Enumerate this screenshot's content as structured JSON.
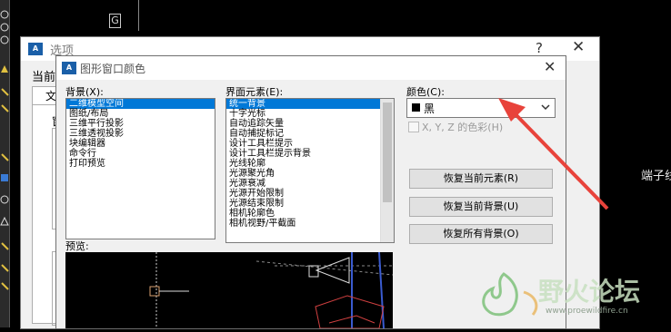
{
  "background": {
    "g_marker": "G",
    "side_text": "端子线",
    "watermark_name": "野火论坛",
    "watermark_url": "www.proewildfire.cn"
  },
  "options_dialog": {
    "logo": "A",
    "title": "选项",
    "help": "?",
    "close": "✕",
    "current_file_label": "当前",
    "tab_label": "文",
    "frag_label": "窗"
  },
  "color_dialog": {
    "logo": "A",
    "title": "图形窗口颜色",
    "close": "✕",
    "context_label": "背景(X):",
    "contexts": [
      {
        "label": "二维模型空间",
        "selected": true
      },
      {
        "label": "图纸/布局",
        "selected": false
      },
      {
        "label": "三维平行投影",
        "selected": false
      },
      {
        "label": "三维透视投影",
        "selected": false
      },
      {
        "label": "块编辑器",
        "selected": false
      },
      {
        "label": "命令行",
        "selected": false
      },
      {
        "label": "打印预览",
        "selected": false
      }
    ],
    "elements_label": "界面元素(E):",
    "elements": [
      {
        "label": "统一背景",
        "selected": true
      },
      {
        "label": "十字光标",
        "selected": false
      },
      {
        "label": "自动追踪矢量",
        "selected": false
      },
      {
        "label": "自动捕捉标记",
        "selected": false
      },
      {
        "label": "设计工具栏提示",
        "selected": false
      },
      {
        "label": "设计工具栏提示背景",
        "selected": false
      },
      {
        "label": "光线轮廓",
        "selected": false
      },
      {
        "label": "光源聚光角",
        "selected": false
      },
      {
        "label": "光源衰减",
        "selected": false
      },
      {
        "label": "光源开始限制",
        "selected": false
      },
      {
        "label": "光源结束限制",
        "selected": false
      },
      {
        "label": "相机轮廓色",
        "selected": false
      },
      {
        "label": "相机视野/平截面",
        "selected": false
      }
    ],
    "color_label": "颜色(C):",
    "color_value": "黑",
    "color_swatch": "#000000",
    "xyz_tint_label": "X, Y, Z 的色彩(H)",
    "restore_element": "恢复当前元素(R)",
    "restore_context": "恢复当前背景(U)",
    "restore_all": "恢复所有背景(O)",
    "preview_label": "预览:"
  },
  "colors": {
    "accent": "#0078d7",
    "annotation_arrow": "#e8433b"
  }
}
